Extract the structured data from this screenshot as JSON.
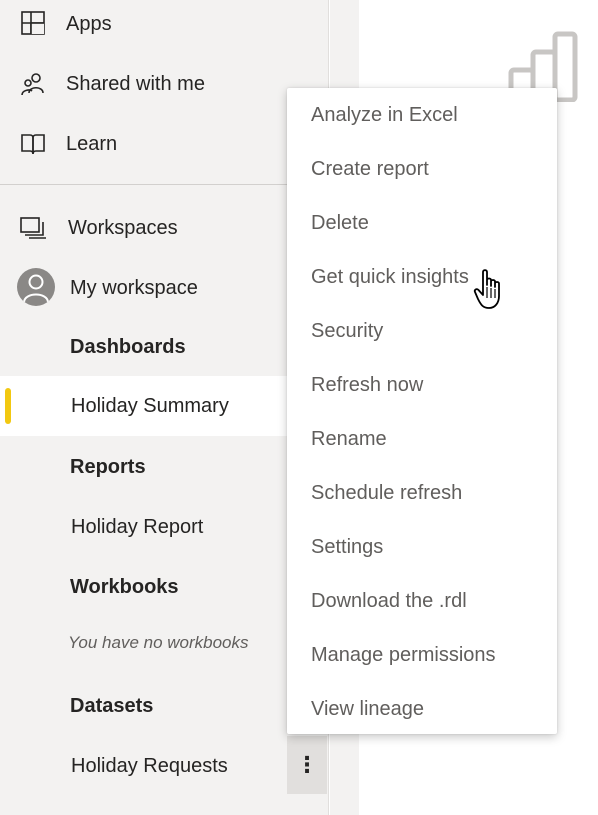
{
  "sidebar": {
    "nav": [
      {
        "label": "Apps",
        "icon": "apps-icon"
      },
      {
        "label": "Shared with me",
        "icon": "shared-users-icon"
      },
      {
        "label": "Learn",
        "icon": "book-icon"
      }
    ],
    "workspaces_label": "Workspaces",
    "my_workspace_label": "My workspace",
    "sections": {
      "dashboards": "Dashboards",
      "reports": "Reports",
      "workbooks": "Workbooks",
      "datasets": "Datasets"
    },
    "items": {
      "dashboard": "Holiday Summary",
      "report": "Holiday Report",
      "workbooks_empty": "You have no workbooks",
      "dataset": "Holiday Requests"
    },
    "more_button": "⋮",
    "selected_color": "#f2c811"
  },
  "context_menu": {
    "items": [
      "Analyze in Excel",
      "Create report",
      "Delete",
      "Get quick insights",
      "Security",
      "Refresh now",
      "Rename",
      "Schedule refresh",
      "Settings",
      "Download the .rdl",
      "Manage permissions",
      "View lineage"
    ]
  }
}
